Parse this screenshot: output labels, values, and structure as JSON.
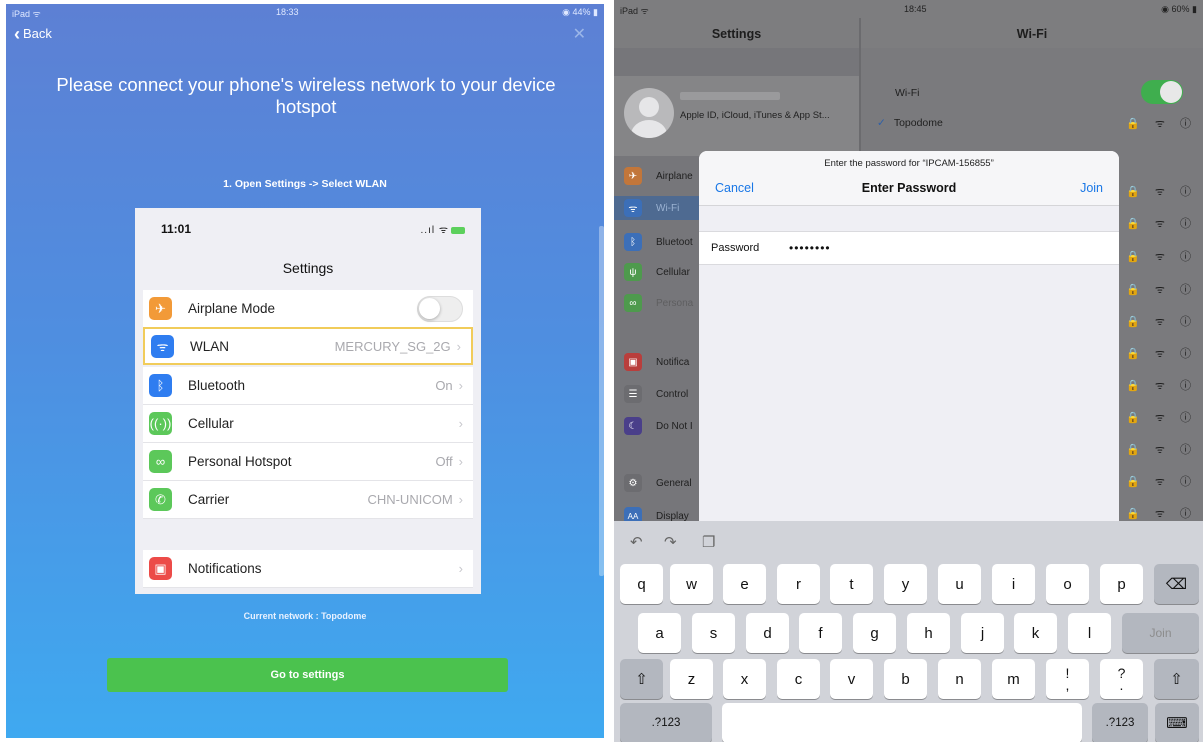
{
  "left": {
    "status": {
      "carrier": "iPad ᯤ",
      "time": "18:33",
      "battery": "◉ 44% ▮"
    },
    "back_label": "Back",
    "heading": "Please connect your phone's wireless network to your device hotspot",
    "step": "1. Open Settings -> Select WLAN",
    "phone": {
      "time": "11:01",
      "signal": "..ıl ᯤ",
      "title": "Settings",
      "rows": [
        {
          "label": "Airplane Mode",
          "value": "",
          "icon": "airplane-icon",
          "color": "#f29a38"
        },
        {
          "label": "WLAN",
          "value": "MERCURY_SG_2G",
          "icon": "wifi-icon",
          "color": "#2f7df0"
        },
        {
          "label": "Bluetooth",
          "value": "On",
          "icon": "bluetooth-icon",
          "color": "#2f7df0"
        },
        {
          "label": "Cellular",
          "value": "",
          "icon": "antenna-icon",
          "color": "#5cc85a"
        },
        {
          "label": "Personal Hotspot",
          "value": "Off",
          "icon": "link-icon",
          "color": "#5cc85a"
        },
        {
          "label": "Carrier",
          "value": "CHN-UNICOM",
          "icon": "phone-icon",
          "color": "#5cc85a"
        },
        {
          "label": "Notifications",
          "value": "",
          "icon": "notifications-icon",
          "color": "#ec4b48"
        }
      ]
    },
    "current_network": "Current network : Topodome",
    "go_button": "Go to settings"
  },
  "right": {
    "status": {
      "device": "iPad ᯤ",
      "time": "18:45",
      "battery": "◉ 60% ▮"
    },
    "settings_title": "Settings",
    "wifi_title": "Wi-Fi",
    "profile_sub": "Apple ID, iCloud, iTunes & App St...",
    "sidebar": [
      {
        "label": "Airplane",
        "icon": "airplane-icon",
        "color": "#c2763a"
      },
      {
        "label": "Wi-Fi",
        "icon": "wifi-icon",
        "color": "#3c6fb8"
      },
      {
        "label": "Bluetoot",
        "icon": "bluetooth-icon",
        "color": "#3c6fb8"
      },
      {
        "label": "Cellular",
        "icon": "antenna-icon",
        "color": "#4e9a4d"
      },
      {
        "label": "Persona",
        "icon": "link-icon",
        "color": "#4e9a4d"
      },
      {
        "label": "Notifica",
        "icon": "notifications-icon",
        "color": "#b93e3c"
      },
      {
        "label": "Control",
        "icon": "control-center-icon",
        "color": "#6c6c70"
      },
      {
        "label": "Do Not I",
        "icon": "moon-icon",
        "color": "#4a3f8a"
      },
      {
        "label": "General",
        "icon": "gear-icon",
        "color": "#6c6c70"
      },
      {
        "label": "Display",
        "icon": "display-icon",
        "color": "#3c6fb8"
      }
    ],
    "wifi_label": "Wi-Fi",
    "connected_network": "Topodome",
    "network_icons": "🔒 ᯤ ⓘ",
    "modal": {
      "prompt": "Enter the password for “IPCAM-156855”",
      "cancel": "Cancel",
      "title": "Enter Password",
      "join": "Join",
      "password_label": "Password",
      "password_value": "••••••••"
    },
    "keyboard": {
      "row1": [
        "q",
        "w",
        "e",
        "r",
        "t",
        "y",
        "u",
        "i",
        "o",
        "p"
      ],
      "row2": [
        "a",
        "s",
        "d",
        "f",
        "g",
        "h",
        "j",
        "k",
        "l"
      ],
      "row3": [
        "z",
        "x",
        "c",
        "v",
        "b",
        "n",
        "m"
      ],
      "join_key": "Join",
      "numbers_key": ".?123",
      "punct1_top": "!",
      "punct1_bottom": ",",
      "punct2_top": "?",
      "punct2_bottom": "."
    }
  }
}
